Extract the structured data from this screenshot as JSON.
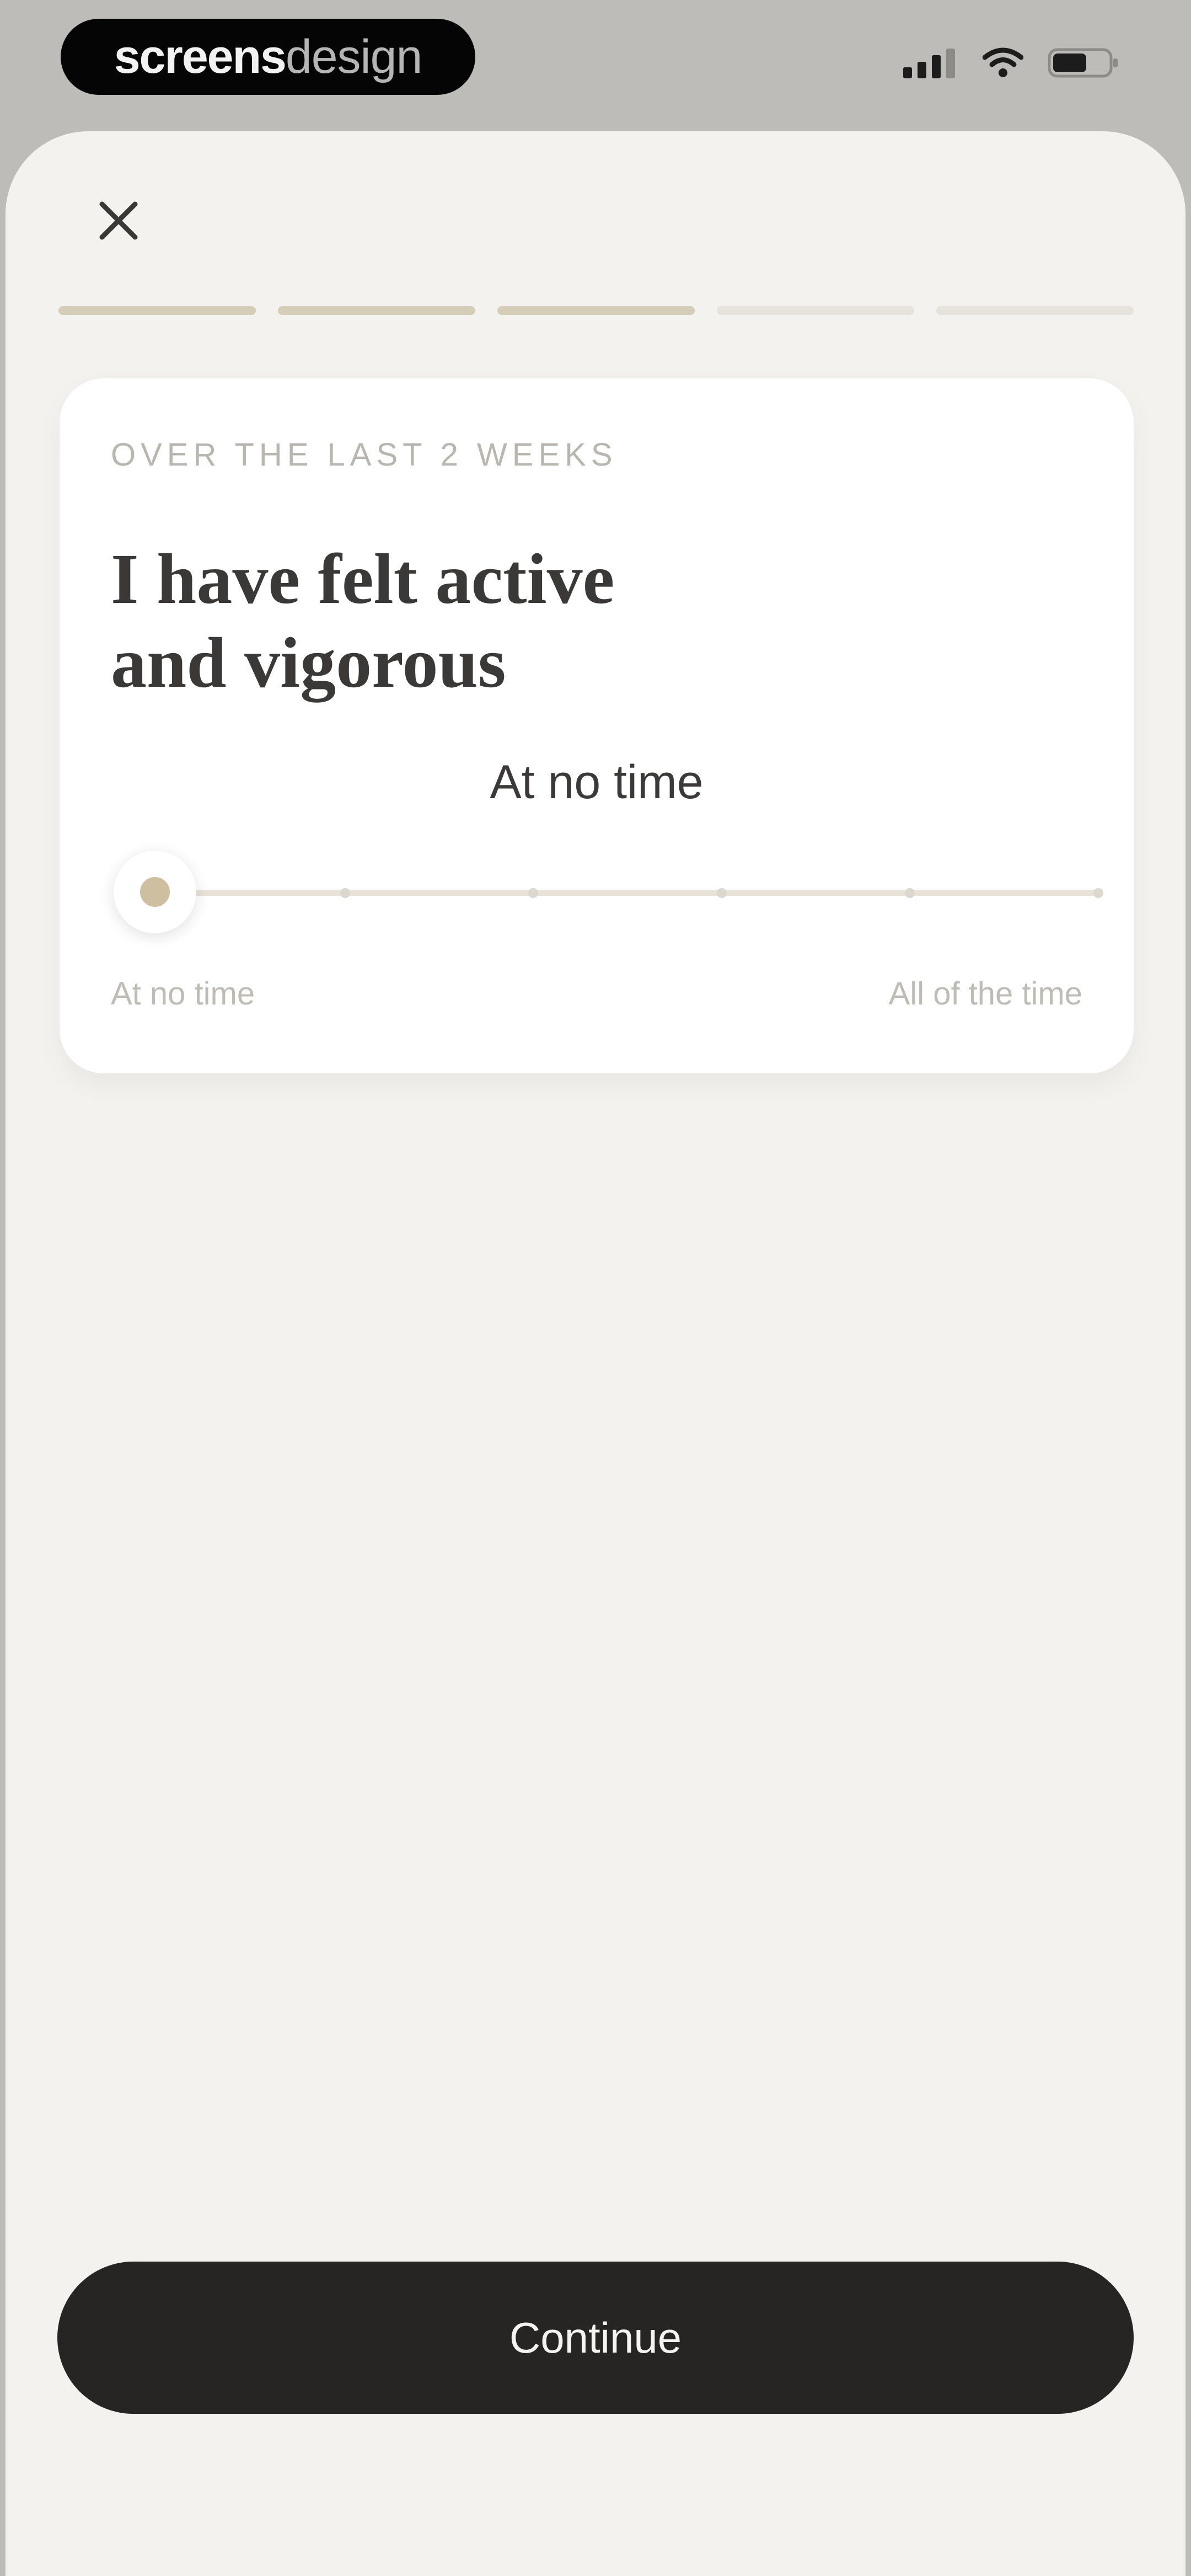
{
  "status_bar": {
    "brand_bold": "screens",
    "brand_light": "design",
    "icons": [
      "cellular-signal-icon",
      "wifi-icon",
      "battery-icon"
    ]
  },
  "header": {
    "close_icon": "close-icon",
    "progress": {
      "total_steps": 5,
      "completed_steps": 3
    }
  },
  "question_card": {
    "eyebrow": "OVER THE LAST 2 WEEKS",
    "question_line1": "I have felt active",
    "question_line2": "and vigorous",
    "selected_value": "At no time",
    "slider": {
      "steps": 6,
      "selected_index": 0
    },
    "scale_min_label": "At no time",
    "scale_max_label": "All of the time"
  },
  "footer": {
    "continue_label": "Continue"
  },
  "colors": {
    "accent": "#cdbf9f",
    "progress_done": "#d6cdb8",
    "progress_todo": "#e6e3dc",
    "button_bg": "#262523",
    "sheet_bg": "#f3f2ee"
  }
}
